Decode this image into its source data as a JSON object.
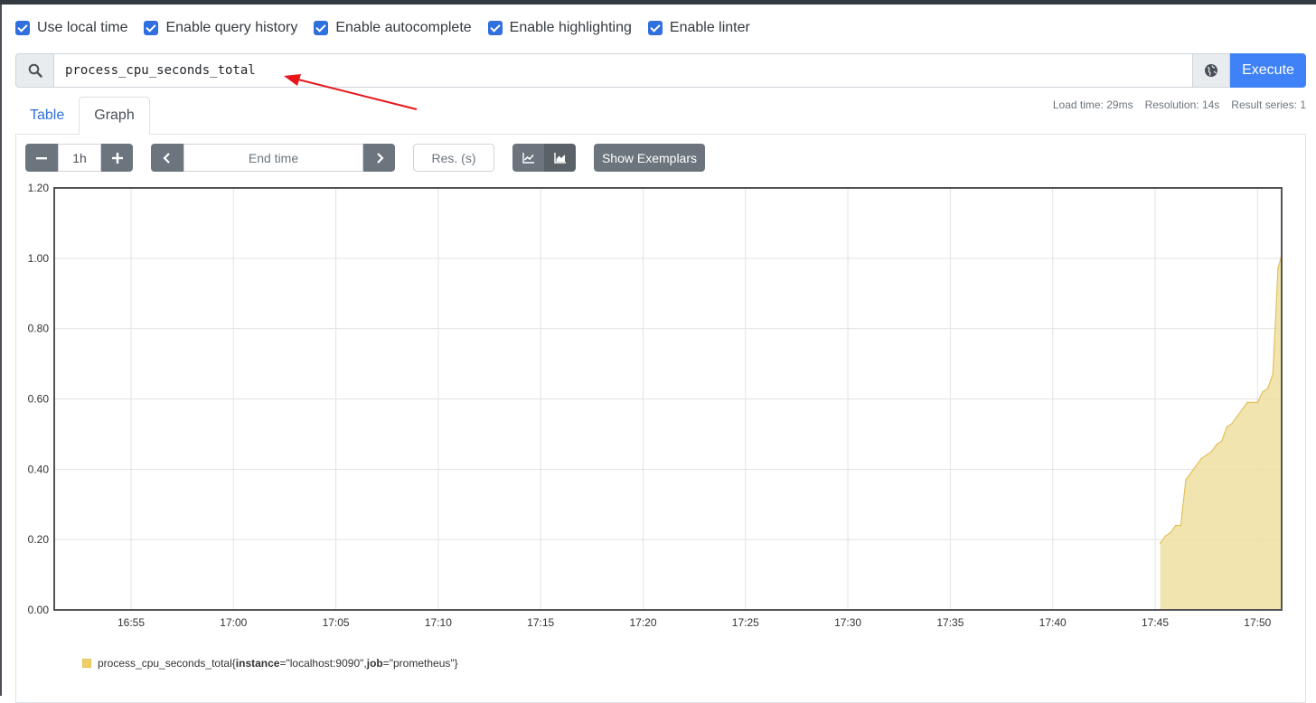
{
  "options": [
    {
      "label": "Use local time",
      "checked": true
    },
    {
      "label": "Enable query history",
      "checked": true
    },
    {
      "label": "Enable autocomplete",
      "checked": true
    },
    {
      "label": "Enable highlighting",
      "checked": true
    },
    {
      "label": "Enable linter",
      "checked": true
    }
  ],
  "query": {
    "value": "process_cpu_seconds_total",
    "execute_label": "Execute"
  },
  "tabs": [
    {
      "label": "Table",
      "active": false
    },
    {
      "label": "Graph",
      "active": true
    }
  ],
  "stats": {
    "load_time": "Load time: 29ms",
    "resolution": "Resolution: 14s",
    "result_series": "Result series: 1"
  },
  "controls": {
    "range_value": "1h",
    "end_time_placeholder": "End time",
    "resolution_placeholder": "Res. (s)",
    "exemplars_label": "Show Exemplars"
  },
  "colors": {
    "accent": "#3f82f7",
    "series_fill": "#f0dfa0",
    "series_line": "#e2c15c",
    "annotation_arrow": "#e8161b"
  },
  "chart_data": {
    "type": "area",
    "ylim": [
      0,
      1.2
    ],
    "yticks": [
      "0.00",
      "0.20",
      "0.40",
      "0.60",
      "0.80",
      "1.00",
      "1.20"
    ],
    "xticks": [
      "16:55",
      "17:00",
      "17:05",
      "17:10",
      "17:15",
      "17:20",
      "17:25",
      "17:30",
      "17:35",
      "17:40",
      "17:45",
      "17:50"
    ],
    "grid": true,
    "series": [
      {
        "name": "process_cpu_seconds_total{instance=\"localhost:9090\", job=\"prometheus\"}",
        "x": [
          "17:45:15",
          "17:45:30",
          "17:45:45",
          "17:46:00",
          "17:46:15",
          "17:46:30",
          "17:46:45",
          "17:47:00",
          "17:47:15",
          "17:47:30",
          "17:47:45",
          "17:48:00",
          "17:48:15",
          "17:48:30",
          "17:48:45",
          "17:49:00",
          "17:49:15",
          "17:49:30",
          "17:49:45",
          "17:50:00",
          "17:50:15",
          "17:50:30",
          "17:50:45",
          "17:51:00"
        ],
        "values": [
          0.19,
          0.21,
          0.22,
          0.24,
          0.24,
          0.37,
          0.39,
          0.41,
          0.43,
          0.44,
          0.45,
          0.47,
          0.48,
          0.52,
          0.53,
          0.55,
          0.57,
          0.59,
          0.59,
          0.59,
          0.62,
          0.63,
          0.67,
          0.97
        ]
      }
    ],
    "last_value": 1.01
  },
  "legend": {
    "metric": "process_cpu_seconds_total",
    "brace_open": "{",
    "label1_key": "instance",
    "label1_val": "=\"localhost:9090\", ",
    "label2_key": "job",
    "label2_val": "=\"prometheus\"",
    "brace_close": "}"
  }
}
